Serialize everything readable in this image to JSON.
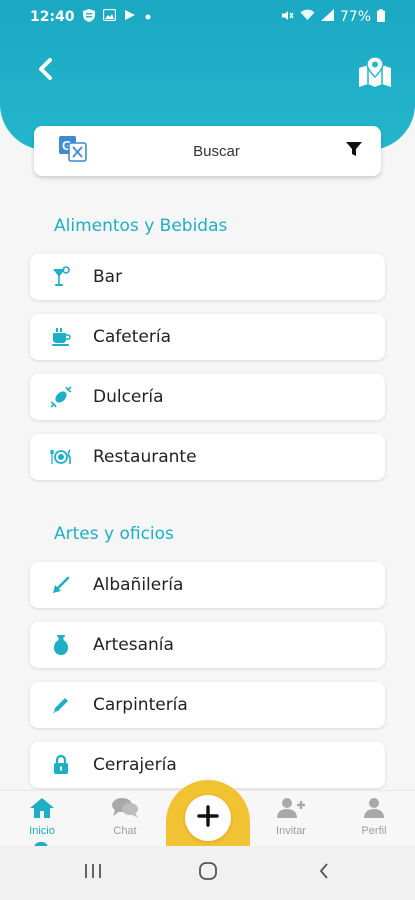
{
  "status_bar": {
    "time": "12:40",
    "battery": "77%",
    "icons_left": [
      "shield-icon",
      "gallery-icon",
      "play-icon",
      "dot-icon"
    ],
    "icons_right": [
      "mute-icon",
      "wifi-icon",
      "signal-icon",
      "battery-icon"
    ]
  },
  "header": {
    "color": "#1aa8c2",
    "back_icon": "chevron-left-icon",
    "map_icon": "map-pin-icon"
  },
  "search": {
    "label": "Buscar",
    "translate_icon": "translate-icon",
    "filter_icon": "filter-icon"
  },
  "sections": [
    {
      "title": "Alimentos y Bebidas",
      "items": [
        {
          "label": "Bar",
          "icon": "cocktail-icon"
        },
        {
          "label": "Cafetería",
          "icon": "coffee-cup-icon"
        },
        {
          "label": "Dulcería",
          "icon": "candy-icon"
        },
        {
          "label": "Restaurante",
          "icon": "plate-cutlery-icon"
        }
      ]
    },
    {
      "title": "Artes y oficios",
      "items": [
        {
          "label": "Albañilería",
          "icon": "trowel-icon"
        },
        {
          "label": "Artesanía",
          "icon": "vase-icon"
        },
        {
          "label": "Carpintería",
          "icon": "pencil-icon"
        },
        {
          "label": "Cerrajería",
          "icon": "lock-icon"
        }
      ]
    }
  ],
  "bottom_nav": {
    "items": [
      {
        "label": "Inicio",
        "icon": "home-icon",
        "active": true
      },
      {
        "label": "Chat",
        "icon": "chat-icon",
        "active": false
      },
      {
        "label": "Invitar",
        "icon": "add-user-icon",
        "active": false
      },
      {
        "label": "Perfil",
        "icon": "user-icon",
        "active": false
      }
    ],
    "fab_icon": "plus-icon",
    "accent": "#1eafc5",
    "fab_color": "#f1c232"
  },
  "system_nav": {
    "icons": [
      "recent-apps-icon",
      "home-circle-icon",
      "back-icon"
    ]
  }
}
